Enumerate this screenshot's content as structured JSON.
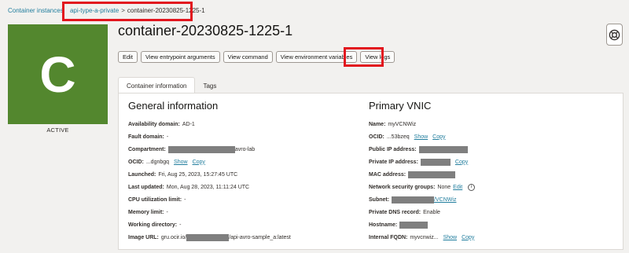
{
  "breadcrumb": {
    "root": "Container instances",
    "instance": "api-type-a-private",
    "separator": ">",
    "current": "container-20230825-1225-1"
  },
  "tile": {
    "letter": "C",
    "state": "ACTIVE",
    "color": "#53872e"
  },
  "page_title": "container-20230825-1225-1",
  "actions": [
    "Edit",
    "View entrypoint arguments",
    "View command",
    "View environment variables",
    "View logs"
  ],
  "tabs": [
    {
      "label": "Container information",
      "active": true
    },
    {
      "label": "Tags",
      "active": false
    }
  ],
  "general": {
    "heading": "General information",
    "availability_domain": {
      "label": "Availability domain:",
      "value": "AD-1"
    },
    "fault_domain": {
      "label": "Fault domain:",
      "value": "-"
    },
    "compartment": {
      "label": "Compartment:",
      "value": "avro-lab"
    },
    "ocid": {
      "label": "OCID:",
      "value": "...dgnbgq",
      "show": "Show",
      "copy": "Copy"
    },
    "launched": {
      "label": "Launched:",
      "value": "Fri, Aug 25, 2023, 15:27:45 UTC"
    },
    "last_updated": {
      "label": "Last updated:",
      "value": "Mon, Aug 28, 2023, 11:11:24 UTC"
    },
    "cpu_limit": {
      "label": "CPU utilization limit:",
      "value": "-"
    },
    "memory_limit": {
      "label": "Memory limit:",
      "value": "-"
    },
    "working_dir": {
      "label": "Working directory:",
      "value": "-"
    },
    "image_url": {
      "label": "Image URL:",
      "prefix": "gru.ocir.io/",
      "suffix": "/api-avro-sample_a:latest"
    }
  },
  "vnic": {
    "heading": "Primary VNIC",
    "name": {
      "label": "Name:",
      "value": "myVCNWiz"
    },
    "ocid": {
      "label": "OCID:",
      "value": "...53bzeq",
      "show": "Show",
      "copy": "Copy"
    },
    "public_ip": {
      "label": "Public IP address:"
    },
    "private_ip": {
      "label": "Private IP address:",
      "copy": "Copy"
    },
    "mac": {
      "label": "MAC address:"
    },
    "nsg": {
      "label": "Network security groups:",
      "value": "None",
      "edit": "Edit"
    },
    "subnet": {
      "label": "Subnet:",
      "value": "/VCNWiz"
    },
    "private_dns": {
      "label": "Private DNS record:",
      "value": "Enable"
    },
    "hostname": {
      "label": "Hostname:"
    },
    "fqdn": {
      "label": "Internal FQDN:",
      "value": "myvcnwiz...",
      "show": "Show",
      "copy": "Copy"
    }
  },
  "colors": {
    "link": "#227e9e",
    "highlight": "#e2161e",
    "redaction": "#7f7f7f"
  }
}
